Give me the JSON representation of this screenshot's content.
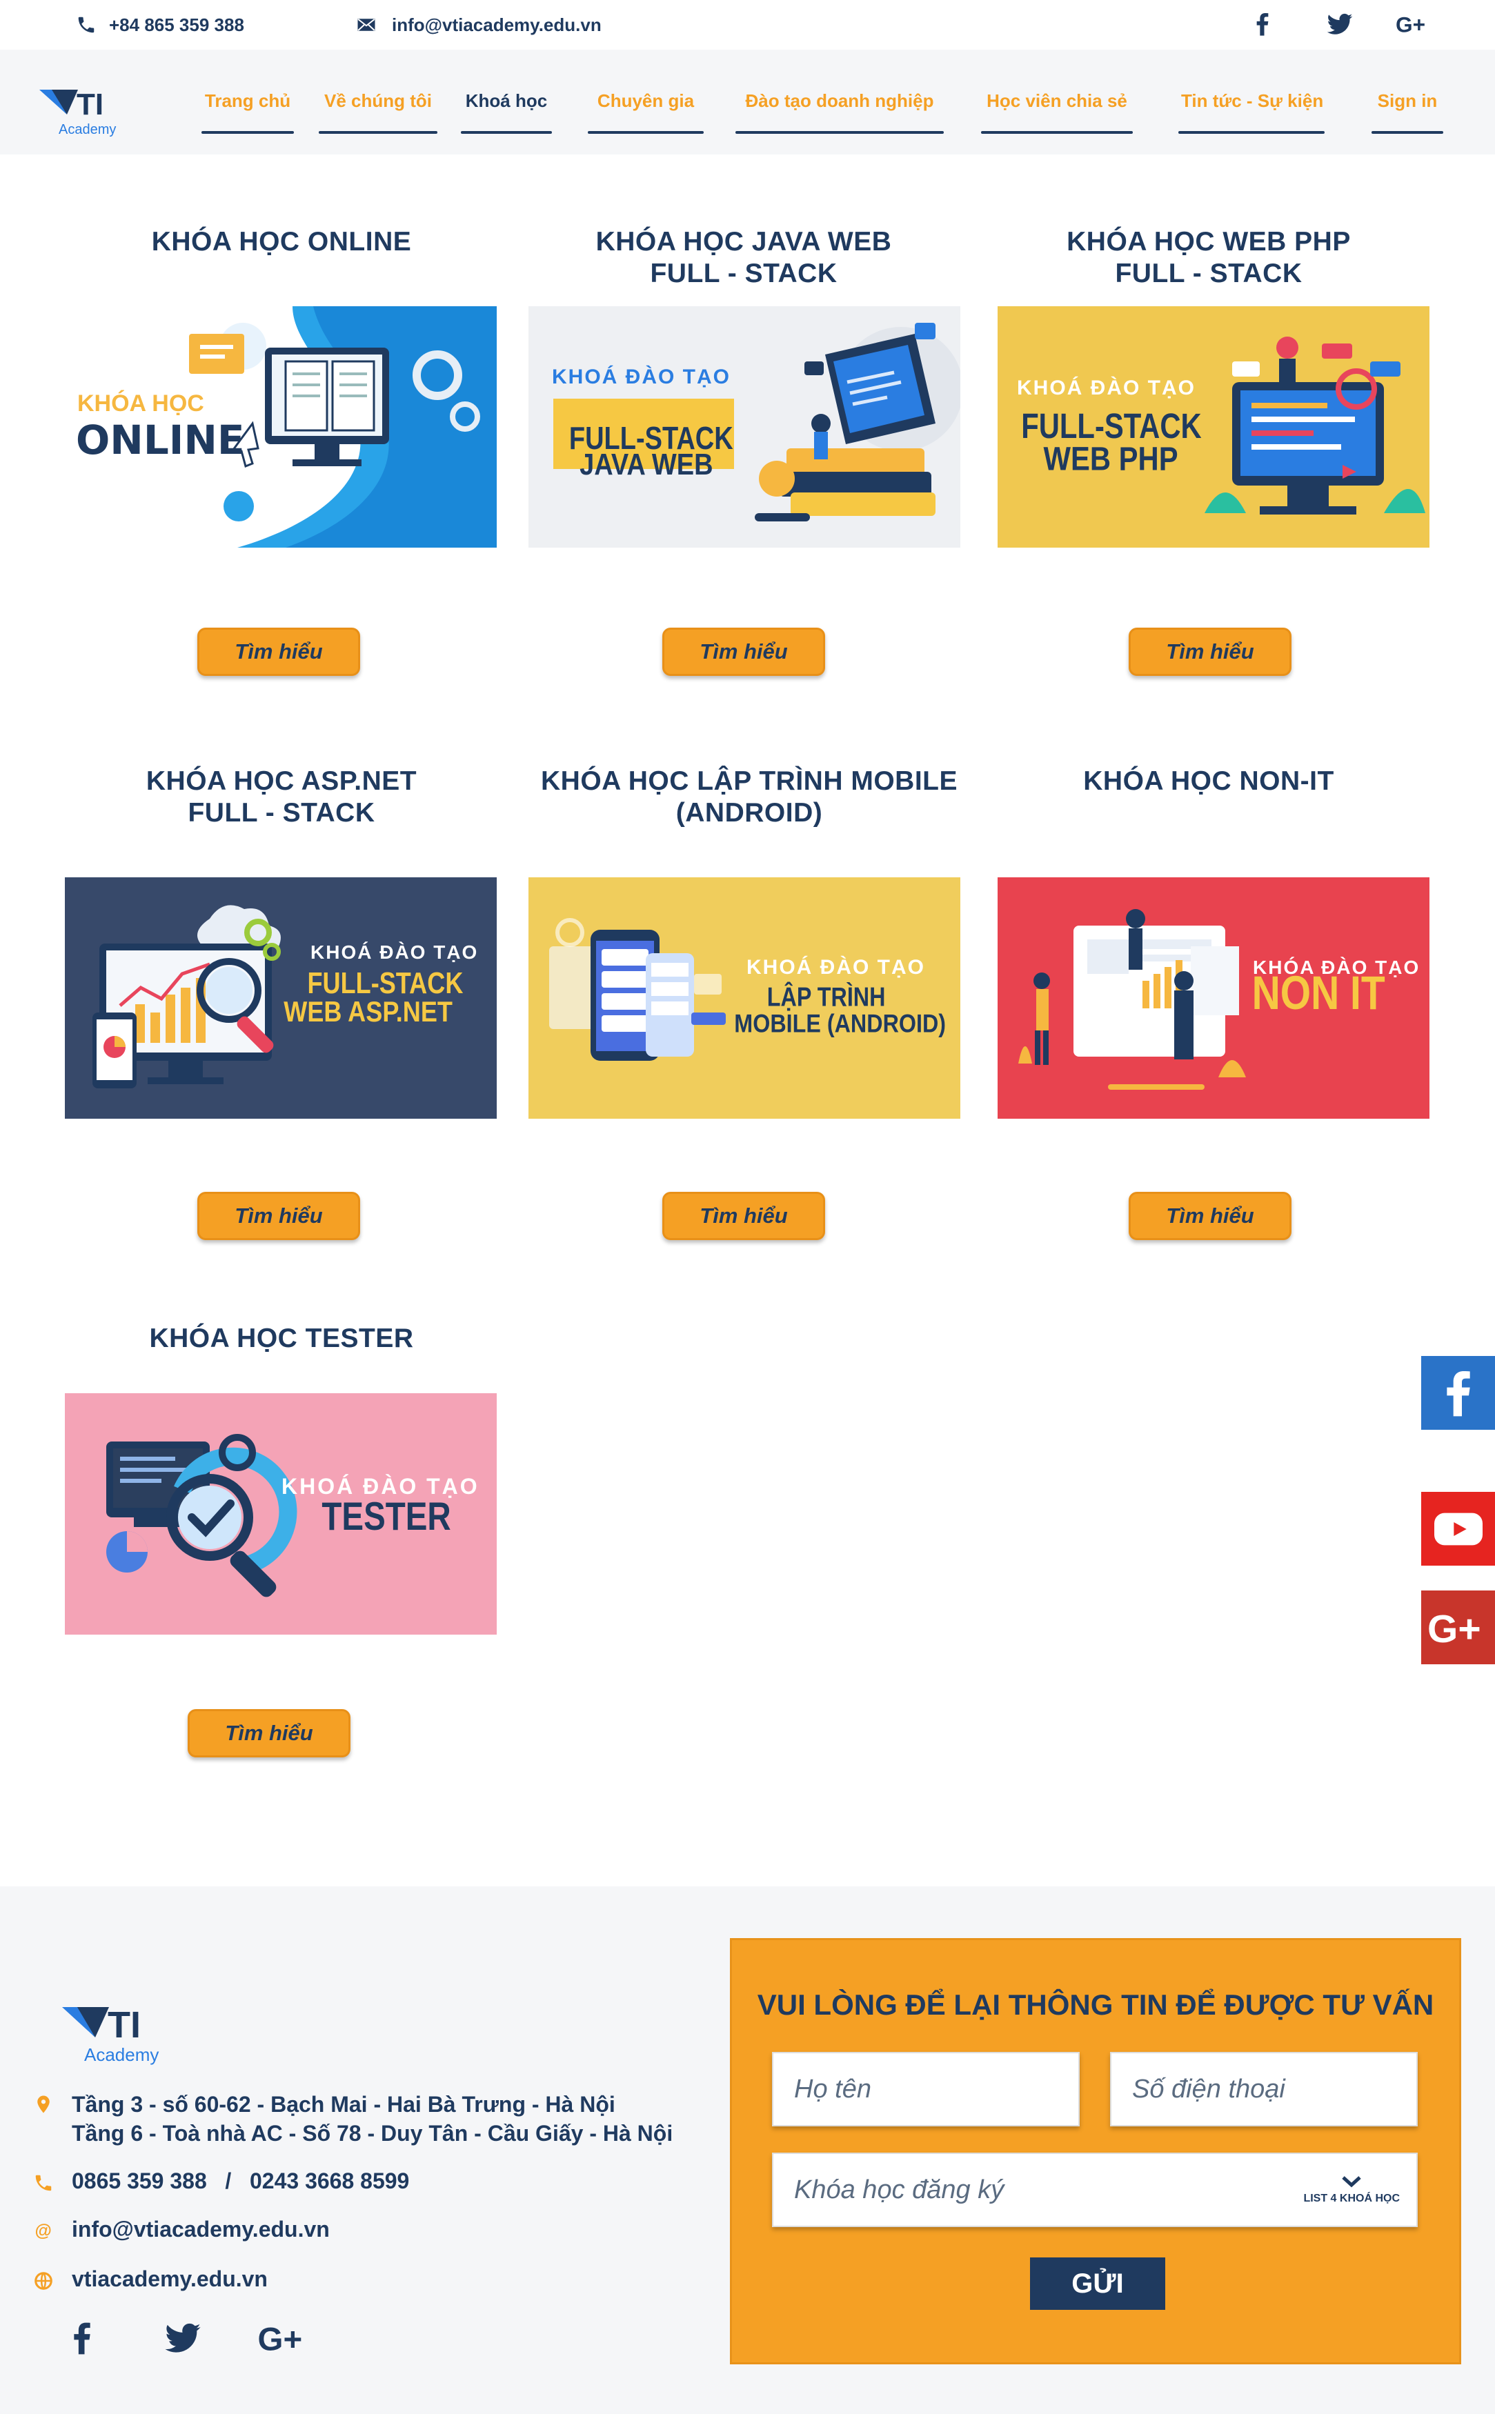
{
  "topbar": {
    "phone": "+84 865 359 388",
    "email": "info@vtiacademy.edu.vn",
    "socials": [
      "facebook-icon",
      "twitter-icon",
      "google-plus-icon"
    ]
  },
  "brand": {
    "name": "VTI",
    "sub": "Academy",
    "colors": {
      "navy": "#1f3a5f",
      "orange": "#f5a024",
      "blue": "#2a7de1"
    }
  },
  "nav": {
    "items": [
      {
        "label": "Trang chủ"
      },
      {
        "label": "Về chúng tôi"
      },
      {
        "label": "Khoá học"
      },
      {
        "label": "Chuyên gia"
      },
      {
        "label": "Đào tạo doanh nghiệp"
      },
      {
        "label": "Học viên chia sẻ"
      },
      {
        "label": "Tin tức - Sự kiện"
      },
      {
        "label": "Sign in"
      }
    ],
    "active": "Khoá học"
  },
  "courses": [
    {
      "title_line1": "KHÓA HỌC ONLINE",
      "title_line2": "",
      "banner_top": "KHÓA HỌC",
      "banner_main": "ONLINE",
      "banner_main2": "",
      "button": "Tìm hiểu"
    },
    {
      "title_line1": "KHÓA HỌC JAVA WEB",
      "title_line2": "FULL - STACK",
      "banner_top": "KHOÁ ĐÀO TẠO",
      "banner_main": "FULL-STACK",
      "banner_main2": "JAVA WEB",
      "button": "Tìm hiểu"
    },
    {
      "title_line1": "KHÓA HỌC WEB PHP",
      "title_line2": "FULL - STACK",
      "banner_top": "KHOÁ ĐÀO TẠO",
      "banner_main": "FULL-STACK",
      "banner_main2": "WEB PHP",
      "button": "Tìm hiểu"
    },
    {
      "title_line1": "KHÓA HỌC ASP.NET",
      "title_line2": "FULL - STACK",
      "banner_top": "KHOÁ ĐÀO TẠO",
      "banner_main": "FULL-STACK",
      "banner_main2": "WEB ASP.NET",
      "button": "Tìm hiểu"
    },
    {
      "title_line1": "KHÓA HỌC LẬP TRÌNH MOBILE",
      "title_line2": "(ANDROID)",
      "banner_top": "KHOÁ ĐÀO TẠO",
      "banner_main": "LẬP TRÌNH",
      "banner_main2": "MOBILE (ANDROID)",
      "button": "Tìm hiểu"
    },
    {
      "title_line1": "KHÓA HỌC NON-IT",
      "title_line2": "",
      "banner_top": "KHÓA ĐÀO TẠO",
      "banner_main": "NON IT",
      "banner_main2": "",
      "button": "Tìm hiểu"
    },
    {
      "title_line1": "KHÓA HỌC TESTER",
      "title_line2": "",
      "banner_top": "KHOÁ ĐÀO TẠO",
      "banner_main": "TESTER",
      "banner_main2": "",
      "button": "Tìm hiểu"
    }
  ],
  "floating_socials": [
    "facebook-icon",
    "youtube-icon",
    "google-plus-icon"
  ],
  "footer": {
    "address_line1": "Tầng 3 - số 60-62 - Bạch Mai -  Hai Bà Trưng - Hà Nội",
    "address_line2": "Tầng 6 - Toà nhà AC - Số 78 - Duy Tân - Cầu Giấy - Hà Nội",
    "phones": "0865 359 388   /   0243 3668 8599",
    "email": "info@vtiacademy.edu.vn",
    "website": "vtiacademy.edu.vn",
    "socials": [
      "facebook-icon",
      "twitter-icon",
      "google-plus-icon"
    ]
  },
  "form": {
    "title": "VUI LÒNG ĐỂ LẠI THÔNG TIN ĐỂ ĐƯỢC TƯ VẤN",
    "name_placeholder": "Họ tên",
    "phone_placeholder": "Số điện thoại",
    "course_placeholder": "Khóa học đăng ký",
    "course_hint": "LIST 4 KHOÁ HỌC",
    "submit": "GỬI"
  }
}
